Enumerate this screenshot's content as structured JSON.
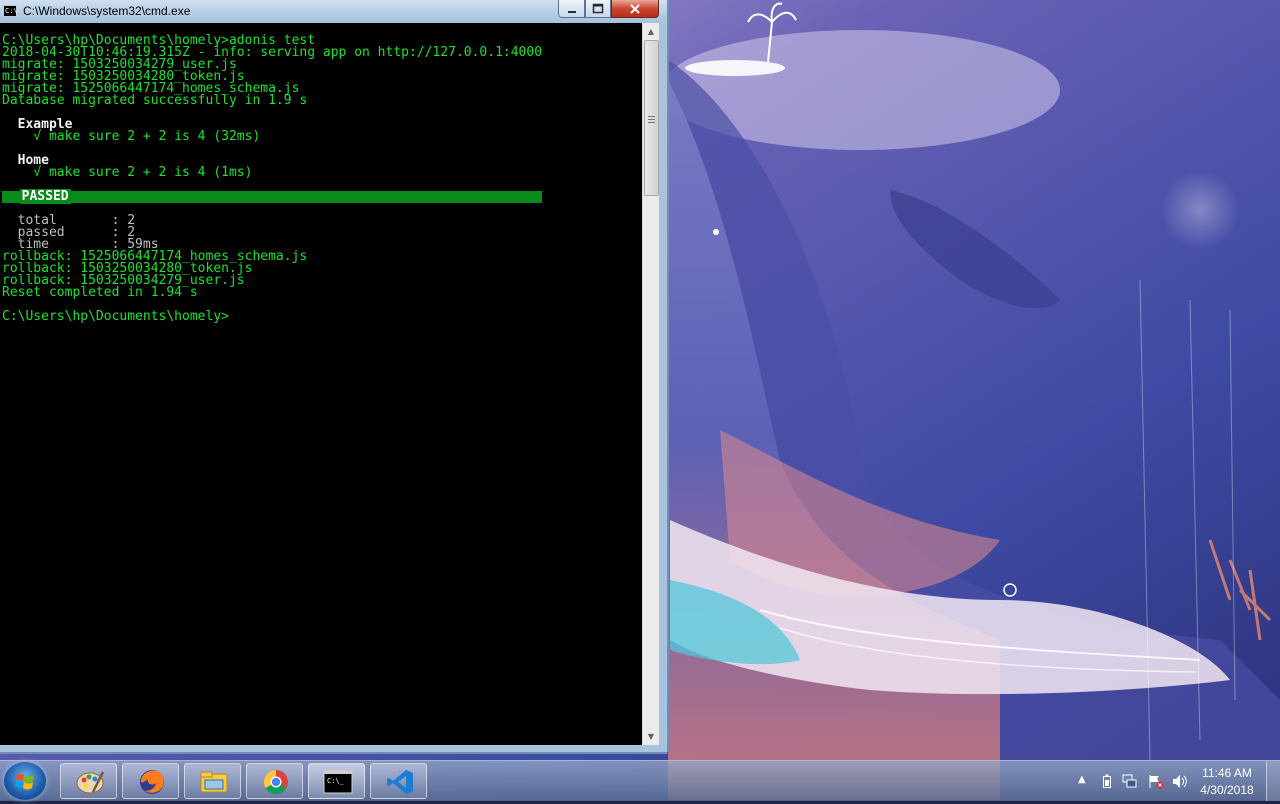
{
  "window": {
    "title": "C:\\Windows\\system32\\cmd.exe",
    "icon_label": "C:\\",
    "minimize_icon": "minimize-icon",
    "maximize_icon": "maximize-icon",
    "close_icon": "close-icon"
  },
  "console": {
    "lines": [
      {
        "text": "C:\\Users\\hp\\Documents\\homely>adonis test",
        "style": "green"
      },
      {
        "text": "2018-04-30T10:46:19.315Z - info: serving app on http://127.0.0.1:4000",
        "style": "green"
      },
      {
        "text": "migrate: 1503250034279_user.js",
        "style": "green"
      },
      {
        "text": "migrate: 1503250034280_token.js",
        "style": "green"
      },
      {
        "text": "migrate: 1525066447174_homes_schema.js",
        "style": "green"
      },
      {
        "text": "Database migrated successfully in 1.9 s",
        "style": "green"
      },
      {
        "text": "",
        "style": "blank"
      },
      {
        "text": "  Example",
        "style": "white"
      },
      {
        "text": "make sure 2 + 2 is 4 (32ms)",
        "style": "check"
      },
      {
        "text": "",
        "style": "blank"
      },
      {
        "text": "  Home",
        "style": "white"
      },
      {
        "text": "make sure 2 + 2 is 4 (1ms)",
        "style": "check"
      },
      {
        "text": "",
        "style": "blank"
      },
      {
        "text": "PASSED",
        "style": "badge"
      },
      {
        "text": "",
        "style": "blank"
      },
      {
        "text": "  total       : 2",
        "style": "gray"
      },
      {
        "text": "  passed      : 2",
        "style": "gray"
      },
      {
        "text": "  time        : 59ms",
        "style": "gray"
      },
      {
        "text": "rollback: 1525066447174_homes_schema.js",
        "style": "green"
      },
      {
        "text": "rollback: 1503250034280_token.js",
        "style": "green"
      },
      {
        "text": "rollback: 1503250034279_user.js",
        "style": "green"
      },
      {
        "text": "Reset completed in 1.94 s",
        "style": "green"
      },
      {
        "text": "",
        "style": "blank"
      },
      {
        "text": "C:\\Users\\hp\\Documents\\homely>",
        "style": "green"
      }
    ],
    "check_glyph": "√",
    "colors": {
      "background": "#000000",
      "text_green": "#1ce32c",
      "text_white": "#f2f2f2",
      "text_gray": "#bfbfbf",
      "badge_bg": "#0b8a1c"
    }
  },
  "scrollbar": {
    "up_icon": "scroll-up-arrow-icon",
    "down_icon": "scroll-down-arrow-icon"
  },
  "taskbar": {
    "start_icon": "windows-start-icon",
    "pinned": [
      {
        "name": "paint-icon"
      },
      {
        "name": "firefox-icon"
      },
      {
        "name": "file-explorer-icon"
      },
      {
        "name": "chrome-icon"
      },
      {
        "name": "cmd-icon",
        "active": true
      },
      {
        "name": "vscode-icon"
      }
    ],
    "cmd_icon_label": "C:\\_",
    "tray_icons": [
      "show-hidden-icons-arrow",
      "battery-icon",
      "network-icon",
      "flag-action-center-icon",
      "volume-icon"
    ],
    "clock": {
      "time": "11:46 AM",
      "date": "4/30/2018"
    }
  }
}
